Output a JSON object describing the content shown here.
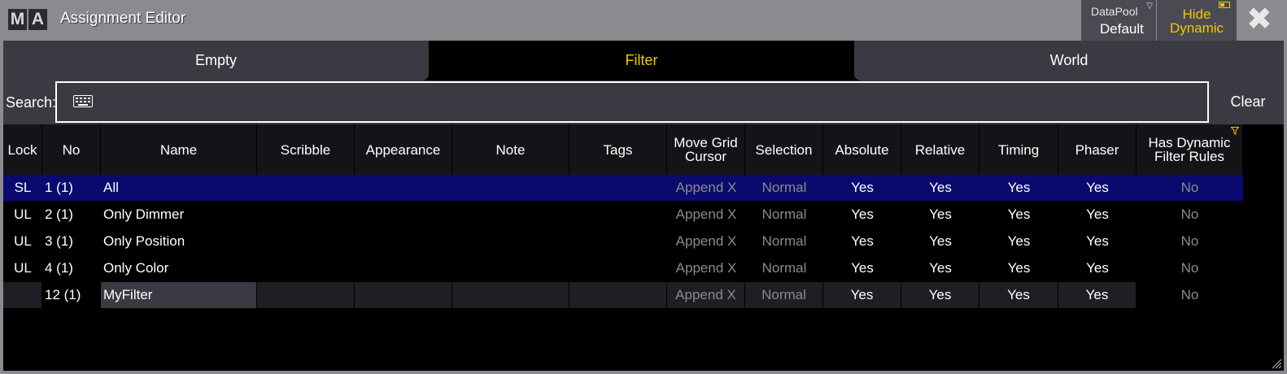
{
  "window": {
    "logo_left": "M",
    "logo_right": "A",
    "title": "Assignment Editor",
    "datapool_label": "DataPool",
    "datapool_value": "Default",
    "hide_dynamic_line1": "Hide",
    "hide_dynamic_line2": "Dynamic",
    "close_symbol": "✖"
  },
  "colors": {
    "accent": "#f0c800",
    "selected_row": "#0a0a6e",
    "titlebar": "#8a8a8f",
    "panel": "#3a3a42"
  },
  "tabs": [
    {
      "label": "Empty",
      "active": false
    },
    {
      "label": "Filter",
      "active": true
    },
    {
      "label": "World",
      "active": false
    }
  ],
  "search": {
    "label": "Search:",
    "value": "",
    "clear_label": "Clear",
    "icon": "keyboard-icon"
  },
  "table": {
    "columns": {
      "lock": "Lock",
      "no": "No",
      "name": "Name",
      "scribble": "Scribble",
      "appearance": "Appearance",
      "note": "Note",
      "tags": "Tags",
      "move_grid_cursor_1": "Move Grid",
      "move_grid_cursor_2": "Cursor",
      "selection": "Selection",
      "absolute": "Absolute",
      "relative": "Relative",
      "timing": "Timing",
      "phaser": "Phaser",
      "has_dynamic_1": "Has Dynamic",
      "has_dynamic_2": "Filter Rules"
    },
    "rows": [
      {
        "lock": "SL",
        "no": "1 (1)",
        "name": "All",
        "move": "Append X",
        "selection": "Normal",
        "absolute": "Yes",
        "relative": "Yes",
        "timing": "Yes",
        "phaser": "Yes",
        "dynamic": "No"
      },
      {
        "lock": "UL",
        "no": "2 (1)",
        "name": "Only Dimmer",
        "move": "Append X",
        "selection": "Normal",
        "absolute": "Yes",
        "relative": "Yes",
        "timing": "Yes",
        "phaser": "Yes",
        "dynamic": "No"
      },
      {
        "lock": "UL",
        "no": "3 (1)",
        "name": "Only Position",
        "move": "Append X",
        "selection": "Normal",
        "absolute": "Yes",
        "relative": "Yes",
        "timing": "Yes",
        "phaser": "Yes",
        "dynamic": "No"
      },
      {
        "lock": "UL",
        "no": "4 (1)",
        "name": "Only Color",
        "move": "Append X",
        "selection": "Normal",
        "absolute": "Yes",
        "relative": "Yes",
        "timing": "Yes",
        "phaser": "Yes",
        "dynamic": "No"
      },
      {
        "lock": "",
        "no": "12 (1)",
        "name": "MyFilter",
        "move": "Append X",
        "selection": "Normal",
        "absolute": "Yes",
        "relative": "Yes",
        "timing": "Yes",
        "phaser": "Yes",
        "dynamic": "No"
      }
    ]
  }
}
